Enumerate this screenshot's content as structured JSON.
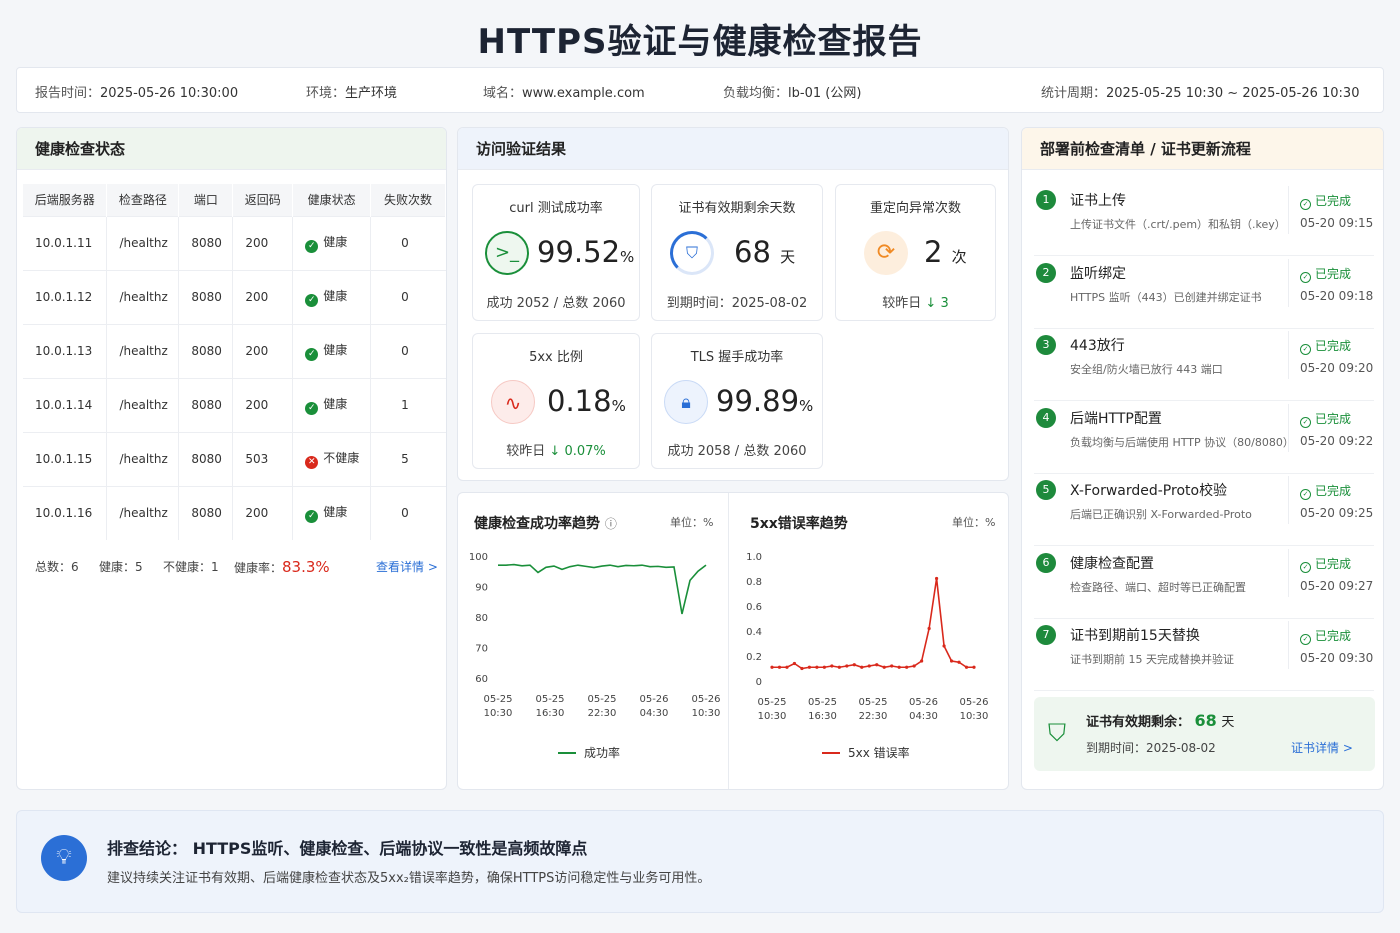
{
  "title": "HTTPS验证与健康检查报告",
  "info": {
    "report_time_label": "报告时间：",
    "report_time": "2025-05-26 10:30:00",
    "env_label": "环境：",
    "env": "生产环境",
    "domain_label": "域名：",
    "domain": "www.example.com",
    "lb_label": "负载均衡：",
    "lb": "lb-01 (公网)",
    "period_label": "统计周期：",
    "period": "2025-05-25 10:30 ~ 2025-05-26 10:30"
  },
  "health": {
    "title": "健康检查状态",
    "columns": [
      "后端服务器",
      "检查路径",
      "端口",
      "返回码",
      "健康状态",
      "失败次数"
    ],
    "rows": [
      {
        "server": "10.0.1.11",
        "path": "/healthz",
        "port": "8080",
        "code": "200",
        "status": "健康",
        "fails": "0",
        "healthy": true
      },
      {
        "server": "10.0.1.12",
        "path": "/healthz",
        "port": "8080",
        "code": "200",
        "status": "健康",
        "fails": "0",
        "healthy": true
      },
      {
        "server": "10.0.1.13",
        "path": "/healthz",
        "port": "8080",
        "code": "200",
        "status": "健康",
        "fails": "0",
        "healthy": true
      },
      {
        "server": "10.0.1.14",
        "path": "/healthz",
        "port": "8080",
        "code": "200",
        "status": "健康",
        "fails": "1",
        "healthy": true
      },
      {
        "server": "10.0.1.15",
        "path": "/healthz",
        "port": "8080",
        "code": "503",
        "status": "不健康",
        "fails": "5",
        "healthy": false
      },
      {
        "server": "10.0.1.16",
        "path": "/healthz",
        "port": "8080",
        "code": "200",
        "status": "健康",
        "fails": "0",
        "healthy": true
      }
    ],
    "total": "总数：6",
    "healthy_count": "健康：5",
    "unhealthy_count": "不健康：1",
    "rate_label": "健康率：",
    "rate": "83.3%",
    "detail_link": "查看详情 >"
  },
  "access": {
    "title": "访问验证结果",
    "curl": {
      "label": "curl 测试成功率",
      "value": "99.52",
      "unit": "%",
      "sub": "成功 2052 / 总数 2060"
    },
    "cert_days": {
      "label": "证书有效期剩余天数",
      "value": "68",
      "unit": "天",
      "sub": "到期时间：2025-08-02"
    },
    "redirect": {
      "label": "重定向异常次数",
      "value": "2",
      "unit": "次",
      "sub_label": "较昨日",
      "sub_value": "3"
    },
    "ratio5xx": {
      "label": "5xx 比例",
      "value": "0.18",
      "unit": "%",
      "sub_label": "较昨日",
      "sub_value": "0.07%"
    },
    "tls": {
      "label": "TLS 握手成功率",
      "value": "99.89",
      "unit": "%",
      "sub": "成功 2058 / 总数 2060"
    }
  },
  "colors": {
    "green": "#1a8f3a",
    "red": "#d9291c",
    "blue": "#2b6fd6",
    "orange": "#f08a24"
  },
  "chart_data": [
    {
      "type": "line",
      "title": "健康检查成功率趋势",
      "unit_label": "单位：%",
      "ylim": [
        60,
        100
      ],
      "yticks": [
        "100",
        "90",
        "80",
        "70",
        "60"
      ],
      "xticks": [
        "05-25\n10:30",
        "05-25\n16:30",
        "05-25\n22:30",
        "05-26\n04:30",
        "05-26\n10:30"
      ],
      "series": [
        {
          "name": "成功率",
          "color": "#1a8f3a",
          "values": [
            97,
            97,
            97.2,
            96.8,
            97,
            94.6,
            96.3,
            96.7,
            95.6,
            96.5,
            97,
            96.6,
            96.2,
            96.7,
            97,
            96.5,
            96.9,
            96.8,
            97,
            96.5,
            96.6,
            96.3,
            96.4,
            81,
            92,
            95,
            97
          ]
        }
      ]
    },
    {
      "type": "line",
      "title": "5xx错误率趋势",
      "unit_label": "单位：%",
      "ylim": [
        0,
        1.0
      ],
      "yticks": [
        "1.0",
        "0.8",
        "0.6",
        "0.4",
        "0.2",
        "0"
      ],
      "xticks": [
        "05-25\n10:30",
        "05-25\n16:30",
        "05-25\n22:30",
        "05-26\n04:30",
        "05-26\n10:30"
      ],
      "series": [
        {
          "name": "5xx 错误率",
          "color": "#d9291c",
          "values": [
            0.11,
            0.11,
            0.11,
            0.14,
            0.1,
            0.11,
            0.11,
            0.11,
            0.12,
            0.11,
            0.12,
            0.13,
            0.11,
            0.12,
            0.13,
            0.11,
            0.12,
            0.11,
            0.11,
            0.12,
            0.16,
            0.42,
            0.82,
            0.28,
            0.16,
            0.15,
            0.11,
            0.11
          ]
        }
      ]
    }
  ],
  "checklist": {
    "title": "部署前检查清单 / 证书更新流程",
    "done_label": "已完成",
    "steps": [
      {
        "n": "1",
        "title": "证书上传",
        "desc": "上传证书文件（.crt/.pem）和私钥（.key）",
        "time": "05-20 09:15"
      },
      {
        "n": "2",
        "title": "监听绑定",
        "desc": "HTTPS 监听（443）已创建并绑定证书",
        "time": "05-20 09:18"
      },
      {
        "n": "3",
        "title": "443放行",
        "desc": "安全组/防火墙已放行 443 端口",
        "time": "05-20 09:20"
      },
      {
        "n": "4",
        "title": "后端HTTP配置",
        "desc": "负载均衡与后端使用 HTTP 协议（80/8080）",
        "time": "05-20 09:22"
      },
      {
        "n": "5",
        "title": "X-Forwarded-Proto校验",
        "desc": "后端已正确识别 X-Forwarded-Proto",
        "time": "05-20 09:25"
      },
      {
        "n": "6",
        "title": "健康检查配置",
        "desc": "检查路径、端口、超时等已正确配置",
        "time": "05-20 09:27"
      },
      {
        "n": "7",
        "title": "证书到期前15天替换",
        "desc": "证书到期前 15 天完成替换并验证",
        "time": "05-20 09:30"
      }
    ],
    "cert_box": {
      "label": "证书有效期剩余：",
      "days": "68",
      "unit": "天",
      "expire": "到期时间：2025-08-02",
      "link": "证书详情 >"
    }
  },
  "conclusion": {
    "title": "排查结论：  HTTPS监听、健康检查、后端协议一致性是高频故障点",
    "text": "建议持续关注证书有效期、后端健康检查状态及5xx₂错误率趋势，确保HTTPS访问稳定性与业务可用性。"
  }
}
